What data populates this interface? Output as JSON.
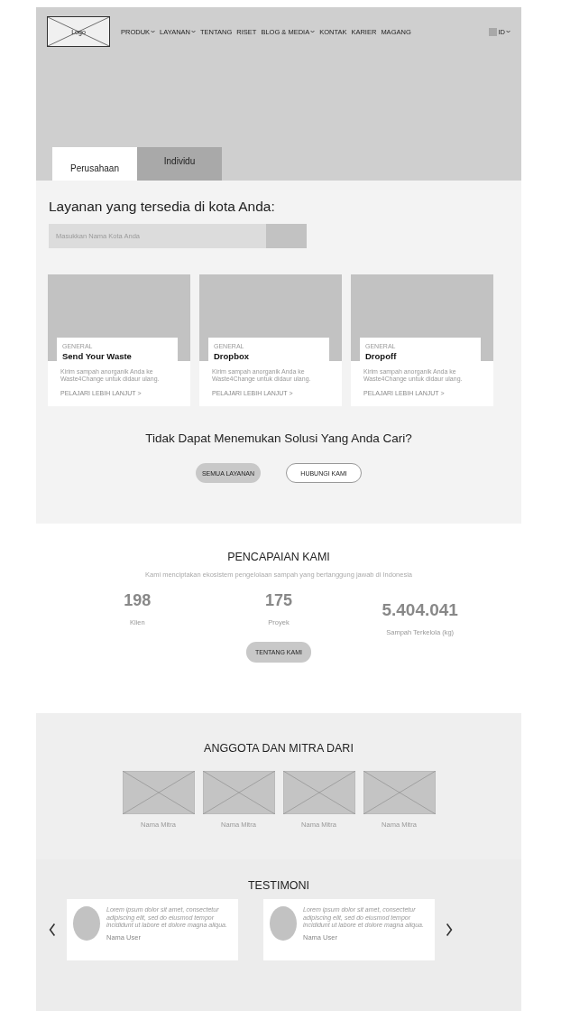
{
  "header": {
    "logo": "Logo",
    "nav": [
      {
        "label": "PRODUK",
        "dropdown": true
      },
      {
        "label": "LAYANAN",
        "dropdown": true
      },
      {
        "label": "TENTANG",
        "dropdown": false
      },
      {
        "label": "RISET",
        "dropdown": false
      },
      {
        "label": "BLOG & MEDIA",
        "dropdown": true
      },
      {
        "label": "KONTAK",
        "dropdown": false
      },
      {
        "label": "KARIER",
        "dropdown": false
      },
      {
        "label": "MAGANG",
        "dropdown": false
      }
    ],
    "language": "ID"
  },
  "tabs": [
    {
      "label": "Perusahaan",
      "selected": true
    },
    {
      "label": "Individu",
      "selected": false
    }
  ],
  "services": {
    "title": "Layanan yang tersedia di kota Anda:",
    "search": {
      "placeholder": "Masukkan Nama Kota Anda"
    },
    "cards": [
      {
        "category": "GENERAL",
        "title": "Send Your Waste",
        "description": "Kirim sampah anorganik Anda ke Waste4Change untuk didaur ulang.",
        "link": "PELAJARI LEBIH LANJUT >"
      },
      {
        "category": "GENERAL",
        "title": "Dropbox",
        "description": "Kirim sampah anorganik Anda ke Waste4Change untuk didaur ulang.",
        "link": "PELAJARI LEBIH LANJUT >"
      },
      {
        "category": "GENERAL",
        "title": "Dropoff",
        "description": "Kirim sampah anorganik Anda ke Waste4Change untuk didaur ulang.",
        "link": "PELAJARI LEBIH LANJUT >"
      }
    ]
  },
  "cta": {
    "title": "Tidak Dapat Menemukan Solusi Yang Anda Cari?",
    "buttons": [
      {
        "label": "SEMUA LAYANAN",
        "kind": "filled"
      },
      {
        "label": "HUBUNGI KAMI",
        "kind": "outline"
      }
    ]
  },
  "achievements": {
    "title": "PENCAPAIAN KAMI",
    "subtitle": "Kami menciptakan ekosistem pengelolaan sampah yang bertanggung jawab di Indonesia",
    "stats": [
      {
        "value": "198",
        "label": "Klien"
      },
      {
        "value": "175",
        "label": "Proyek"
      },
      {
        "value": "5.404.041",
        "label": "Sampah Terkelola (kg)"
      }
    ],
    "button": "TENTANG KAMI"
  },
  "partners": {
    "title": "ANGGOTA DAN MITRA DARI",
    "items": [
      {
        "name": "Nama Mitra"
      },
      {
        "name": "Nama Mitra"
      },
      {
        "name": "Nama Mitra"
      },
      {
        "name": "Nama Mitra"
      }
    ]
  },
  "testimonials": {
    "title": "TESTIMONI",
    "items": [
      {
        "quote": "Lorem ipsum dolor sit amet, consectetur adipiscing elit, sed do eiusmod tempor incididunt ut labore et dolore magna aliqua.",
        "name": "Nama User"
      },
      {
        "quote": "Lorem ipsum dolor sit amet, consectetur adipiscing elit, sed do eiusmod tempor incididunt ut labore et dolore magna aliqua.",
        "name": "Nama User"
      }
    ]
  }
}
